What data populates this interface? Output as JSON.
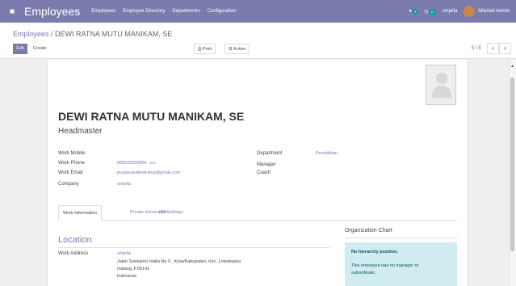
{
  "nav": {
    "brand": "Employees",
    "menu": [
      "Employees",
      "Employee Directory",
      "Departments",
      "Configuration"
    ],
    "chat_badge": "3",
    "activity_badge": "11",
    "company": "smjella",
    "user": "Mitchell Admin"
  },
  "breadcrumb": {
    "parent": "Employees",
    "separator": " / ",
    "current": "DEWI RATNA MUTU MANIKAM, SE"
  },
  "toolbar": {
    "edit": "Edit",
    "create": "Create",
    "print": "⎙ Print",
    "action": "⚙ Action"
  },
  "pager": {
    "value": "5 / 5",
    "prev": "‹",
    "next": "›"
  },
  "employee": {
    "name": "DEWI RATNA MUTU MANIKAM, SE",
    "job_title": "Headmaster"
  },
  "fields_left": [
    {
      "label": "Work Mobile",
      "value": ""
    },
    {
      "label": "Work Phone",
      "value": "085632590856",
      "extra": "SMS"
    },
    {
      "label": "Work Email",
      "value": "puspasaridewiratna@gmail.com"
    },
    {
      "label": "Company",
      "value": "smjella"
    }
  ],
  "fields_right": [
    {
      "label": "Department",
      "value": "Pendidikan"
    },
    {
      "label": "Manager",
      "value": ""
    },
    {
      "label": "Coach",
      "value": ""
    }
  ],
  "tabs": [
    "Work Information",
    "Private Information",
    "HR Settings"
  ],
  "location": {
    "title": "Location",
    "address_label": "Work Address",
    "address_lines": [
      "smjella",
      "Jalan Soekarno Hatta No 9 , Kota/Kabupaten, Kec. Lowokwaru",
      "malang Jl 65141",
      "Indonesia"
    ]
  },
  "org_chart": {
    "title": "Organization Chart",
    "heading": "No hierarchy position.",
    "text": "This employee has no manager or subordinate."
  },
  "colors": {
    "navbar": "#7c7bad",
    "accent": "#7c7bad",
    "info_box": "#d1ecf1"
  }
}
